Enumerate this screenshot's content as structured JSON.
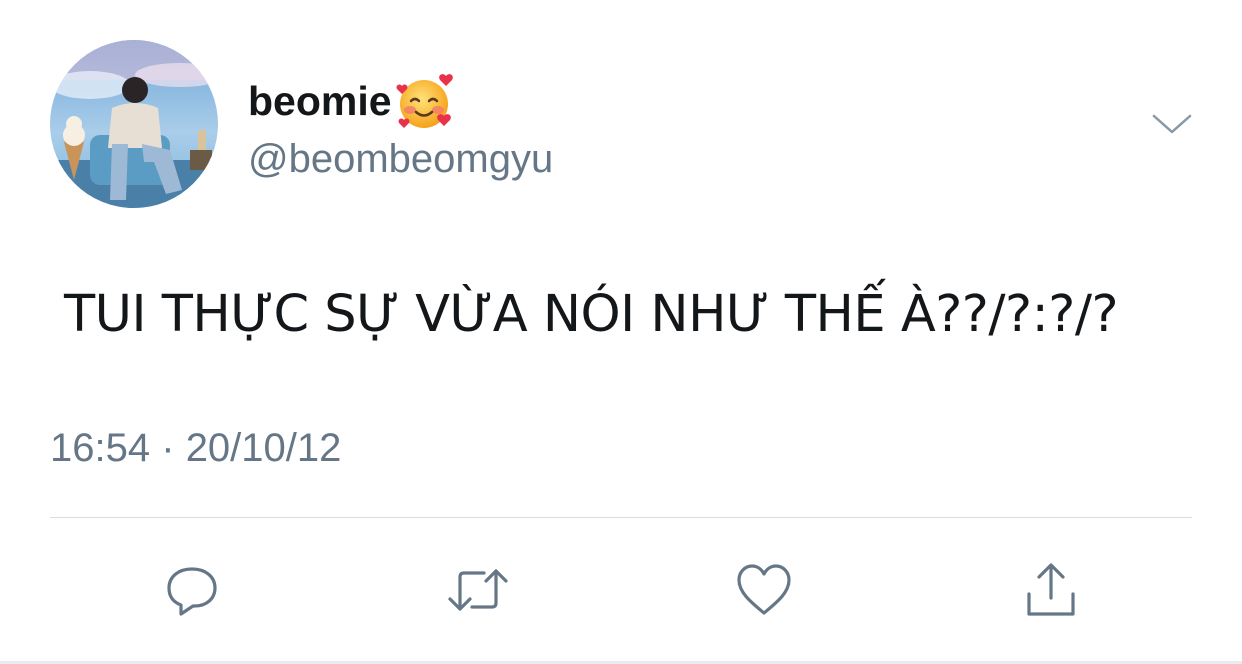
{
  "user": {
    "display_name": "beomie",
    "name_emoji": "smiling-face-with-hearts",
    "handle": "@beombeomgyu",
    "avatar": "profile-photo"
  },
  "tweet": {
    "text": "TUI THỰC SỰ VỪA NÓI NHƯ THẾ À??/?:?/?",
    "time": "16:54",
    "separator": "·",
    "date": "20/10/12"
  },
  "actions": [
    {
      "name": "reply",
      "icon": "reply-icon"
    },
    {
      "name": "retweet",
      "icon": "retweet-icon"
    },
    {
      "name": "like",
      "icon": "heart-icon"
    },
    {
      "name": "share",
      "icon": "share-icon"
    }
  ],
  "colors": {
    "text": "#14171a",
    "secondary": "#657786",
    "divider": "#d8dde1"
  }
}
